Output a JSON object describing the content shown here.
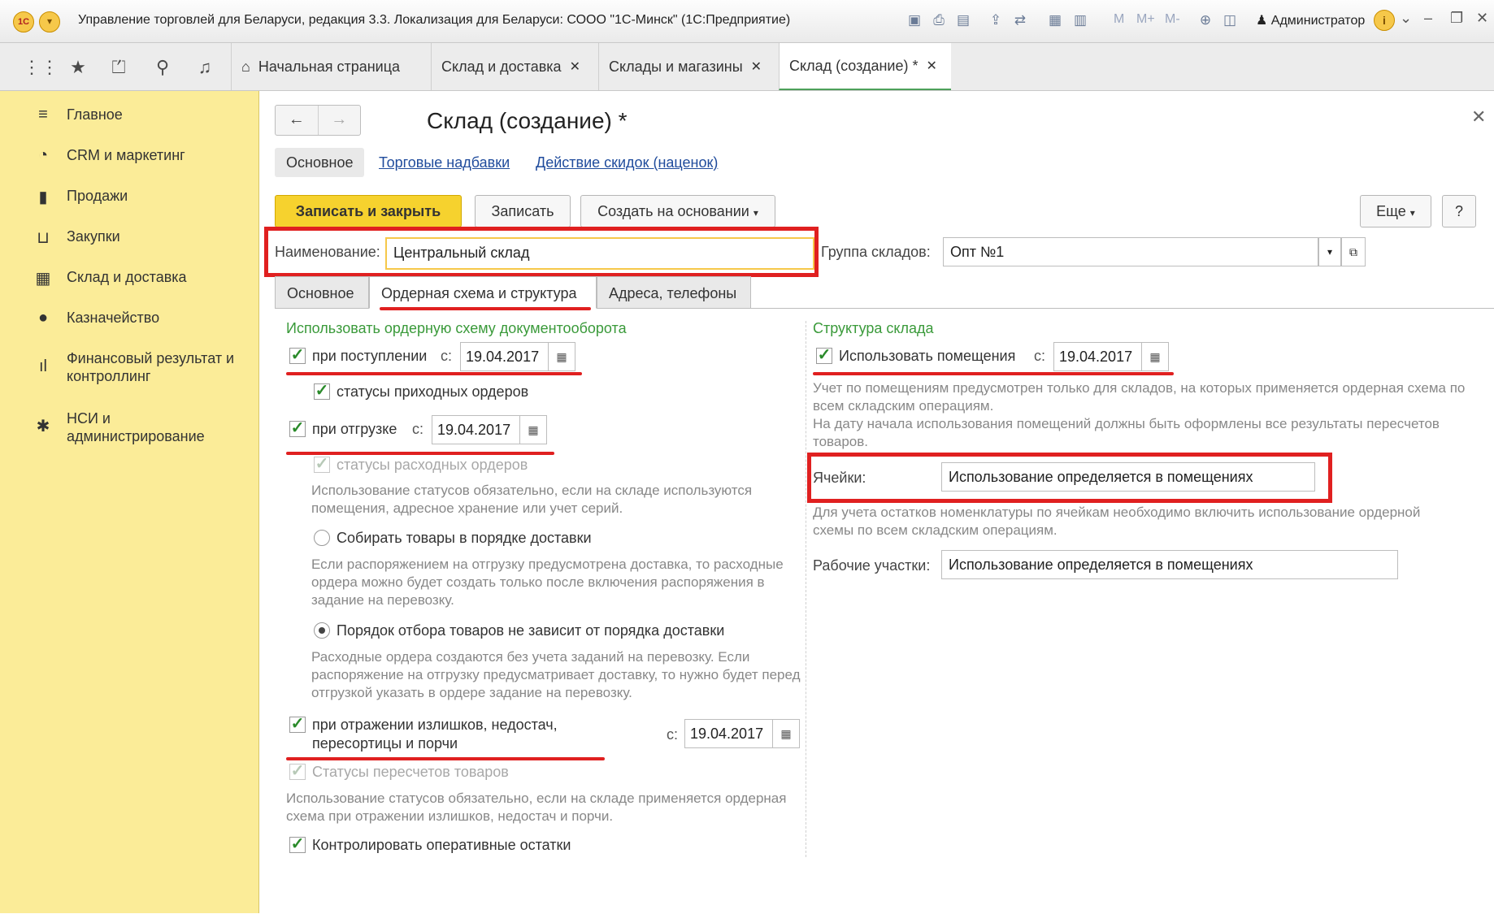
{
  "window": {
    "logo_text": "1С",
    "title": "Управление торговлей для Беларуси, редакция 3.3. Локализация для Беларуси: СООО \"1С-Минск\"  (1С:Предприятие)",
    "memory_buttons": [
      "M",
      "M+",
      "M-"
    ],
    "user": "Администратор"
  },
  "tabs": [
    {
      "label": "Начальная страница",
      "closable": false,
      "active": false
    },
    {
      "label": "Склад и доставка",
      "closable": true,
      "active": false
    },
    {
      "label": "Склады и магазины",
      "closable": true,
      "active": false
    },
    {
      "label": "Склад (создание) *",
      "closable": true,
      "active": true
    }
  ],
  "sidebar": {
    "items": [
      {
        "label": "Главное",
        "icon": "menu-lines-icon"
      },
      {
        "label": "CRM и маркетинг",
        "icon": "pie-chart-icon"
      },
      {
        "label": "Продажи",
        "icon": "shopping-bag-icon"
      },
      {
        "label": "Закупки",
        "icon": "cart-icon"
      },
      {
        "label": "Склад и доставка",
        "icon": "warehouse-grid-icon"
      },
      {
        "label": "Казначейство",
        "icon": "coin-icon"
      },
      {
        "label": "Финансовый результат и контроллинг",
        "icon": "bar-chart-icon"
      },
      {
        "label": "НСИ и администрирование",
        "icon": "gear-icon"
      }
    ]
  },
  "form": {
    "title": "Склад (создание) *",
    "sections": [
      "Основное",
      "Торговые надбавки",
      "Действие скидок (наценок)"
    ],
    "buttons": {
      "save_close": "Записать и закрыть",
      "save": "Записать",
      "create_based": "Создать на основании",
      "more": "Еще",
      "help": "?"
    },
    "name_label": "Наименование:",
    "name_value": "Центральный склад",
    "group_label": "Группа складов:",
    "group_value": "Опт №1",
    "inner_tabs": [
      "Основное",
      "Ордерная схема и структура",
      "Адреса, телефоны"
    ]
  },
  "left": {
    "heading": "Использовать ордерную схему документооборота",
    "receipt_label": "при поступлении",
    "receipt_from": "с:",
    "receipt_date": "19.04.2017",
    "receipt_status_label": "статусы приходных ордеров",
    "shipment_label": "при отгрузке",
    "shipment_from": "с:",
    "shipment_date": "19.04.2017",
    "shipment_status_label": "статусы расходных ордеров",
    "shipment_status_note": "Использование статусов обязательно, если на складе используются помещения, адресное хранение или учет серий.",
    "radio1_label": "Собирать товары в порядке доставки",
    "radio1_note": "Если распоряжением на отгрузку предусмотрена доставка, то расходные ордера можно будет создать только после включения распоряжения в задание на перевозку.",
    "radio2_label": "Порядок отбора товаров не зависит от порядка доставки",
    "radio2_note": "Расходные ордера создаются без учета заданий на перевозку. Если распоряжение на отгрузку предусматривает доставку, то нужно будет перед отгрузкой указать в ордере задание на перевозку.",
    "surplus_label_1": "при отражении излишков, недостач,",
    "surplus_label_2": "пересортицы и порчи",
    "surplus_from": "с:",
    "surplus_date": "19.04.2017",
    "recount_status_label": "Статусы пересчетов товаров",
    "recount_note": "Использование статусов обязательно, если на складе применяется ордерная схема при отражении излишков, недостач и порчи.",
    "control_label": "Контролировать оперативные остатки"
  },
  "right": {
    "heading": "Структура склада",
    "rooms_label": "Использовать помещения",
    "rooms_from": "с:",
    "rooms_date": "19.04.2017",
    "rooms_note": "Учет по помещениям предусмотрен только для складов, на которых применяется ордерная схема по всем складским операциям.\nНа дату начала использования помещений должны быть оформлены все результаты пересчетов товаров.",
    "cells_label": "Ячейки:",
    "cells_value": "Использование определяется в помещениях",
    "cells_note": "Для учета остатков номенклатуры по ячейкам необходимо включить использование ордерной схемы по всем складским операциям.",
    "work_label": "Рабочие участки:",
    "work_value": "Использование определяется в помещениях"
  },
  "colors": {
    "sidebar_bg": "#fbec98",
    "primary_button": "#f6d22e",
    "annotation_red": "#e02020",
    "heading_green": "#3a9a3a",
    "link_blue": "#1f4b9c"
  }
}
